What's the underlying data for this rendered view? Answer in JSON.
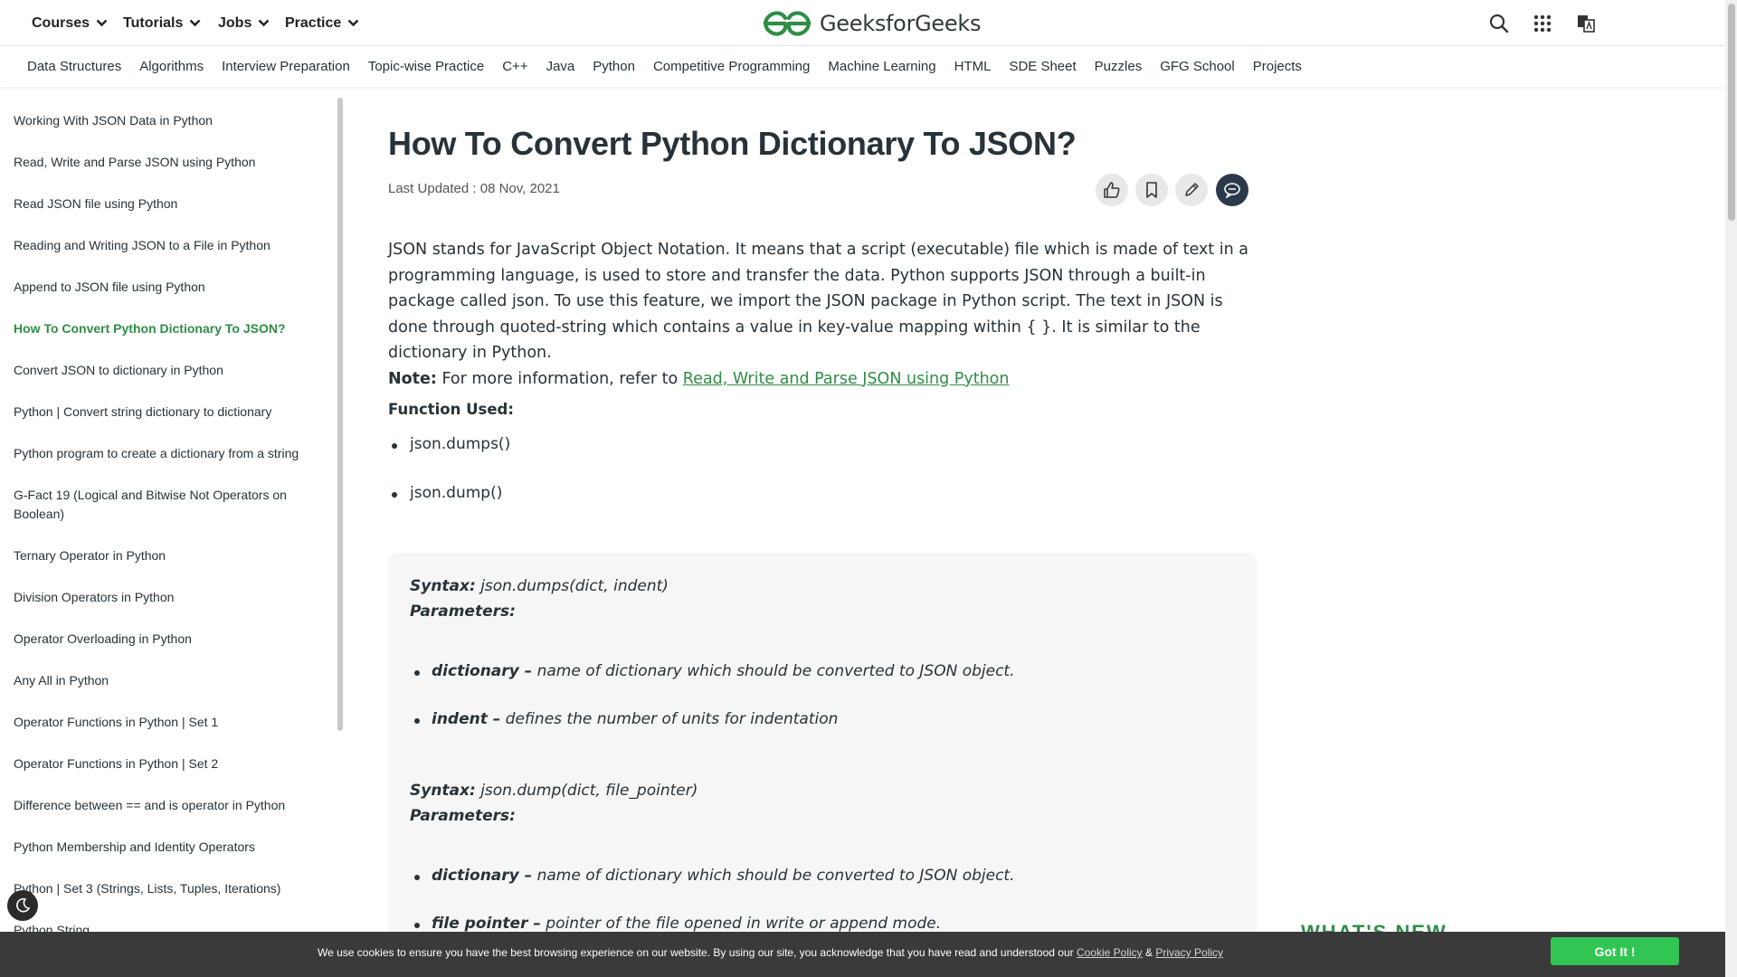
{
  "topnav": {
    "menus": [
      "Courses",
      "Tutorials",
      "Jobs",
      "Practice"
    ],
    "brand": "GeeksforGeeks"
  },
  "subnav": [
    "Data Structures",
    "Algorithms",
    "Interview Preparation",
    "Topic-wise Practice",
    "C++",
    "Java",
    "Python",
    "Competitive Programming",
    "Machine Learning",
    "HTML",
    "SDE Sheet",
    "Puzzles",
    "GFG School",
    "Projects"
  ],
  "sidebar": {
    "active_index": 5,
    "items": [
      "Working With JSON Data in Python",
      "Read, Write and Parse JSON using Python",
      "Read JSON file using Python",
      "Reading and Writing JSON to a File in Python",
      "Append to JSON file using Python",
      "How To Convert Python Dictionary To JSON?",
      "Convert JSON to dictionary in Python",
      "Python | Convert string dictionary to dictionary",
      "Python program to create a dictionary from a string",
      "G-Fact 19 (Logical and Bitwise Not Operators on Boolean)",
      "Ternary Operator in Python",
      "Division Operators in Python",
      "Operator Overloading in Python",
      "Any All in Python",
      "Operator Functions in Python | Set 1",
      "Operator Functions in Python | Set 2",
      "Difference between == and is operator in Python",
      "Python Membership and Identity Operators",
      "Python | Set 3 (Strings, Lists, Tuples, Iterations)",
      "Python String"
    ]
  },
  "article": {
    "title": "How To Convert Python Dictionary To JSON?",
    "updated": "Last Updated : 08 Nov, 2021",
    "intro": "JSON stands for JavaScript Object Notation. It means that a script (executable) file which is made of text in a programming language, is used to store and transfer the data. Python supports JSON through a built-in package called json. To use this feature, we import the JSON package in Python script. The text in JSON is done through quoted-string which contains a value in key-value mapping within { }. It is similar to the dictionary in Python.",
    "note_label": "Note:",
    "note_text": " For more information, refer to ",
    "note_link": "Read, Write and Parse JSON using Python",
    "functions_heading": "Function Used:",
    "functions": [
      "json.dumps()",
      "json.dump()"
    ],
    "syntax1_label": "Syntax:",
    "syntax1": " json.dumps(dict, indent)",
    "params_label": "Parameters:",
    "p1_name": "dictionary –",
    "p1_desc": " name of dictionary which should be converted to JSON object.",
    "p2_name": "indent –",
    "p2_desc": " defines the number of units for indentation",
    "syntax2_label": "Syntax:",
    "syntax2": " json.dump(dict, file_pointer)",
    "params2_label": "Parameters:",
    "p3_name": "dictionary –",
    "p3_desc": " name of dictionary which should be converted to JSON object.",
    "p4_name": "file pointer –",
    "p4_desc": " pointer of the file opened in write or append mode."
  },
  "right_rail": {
    "whats_new": "WHAT'S NEW"
  },
  "cookie": {
    "text": "We use cookies to ensure you have the best browsing experience on our website. By using our site, you acknowledge that you have read and understood our ",
    "cookie_link": "Cookie Policy",
    "amp": " & ",
    "privacy_link": "Privacy Policy",
    "button": "Got It !"
  },
  "colors": {
    "brand_green": "#2f8d46",
    "button_green": "#31c653"
  }
}
